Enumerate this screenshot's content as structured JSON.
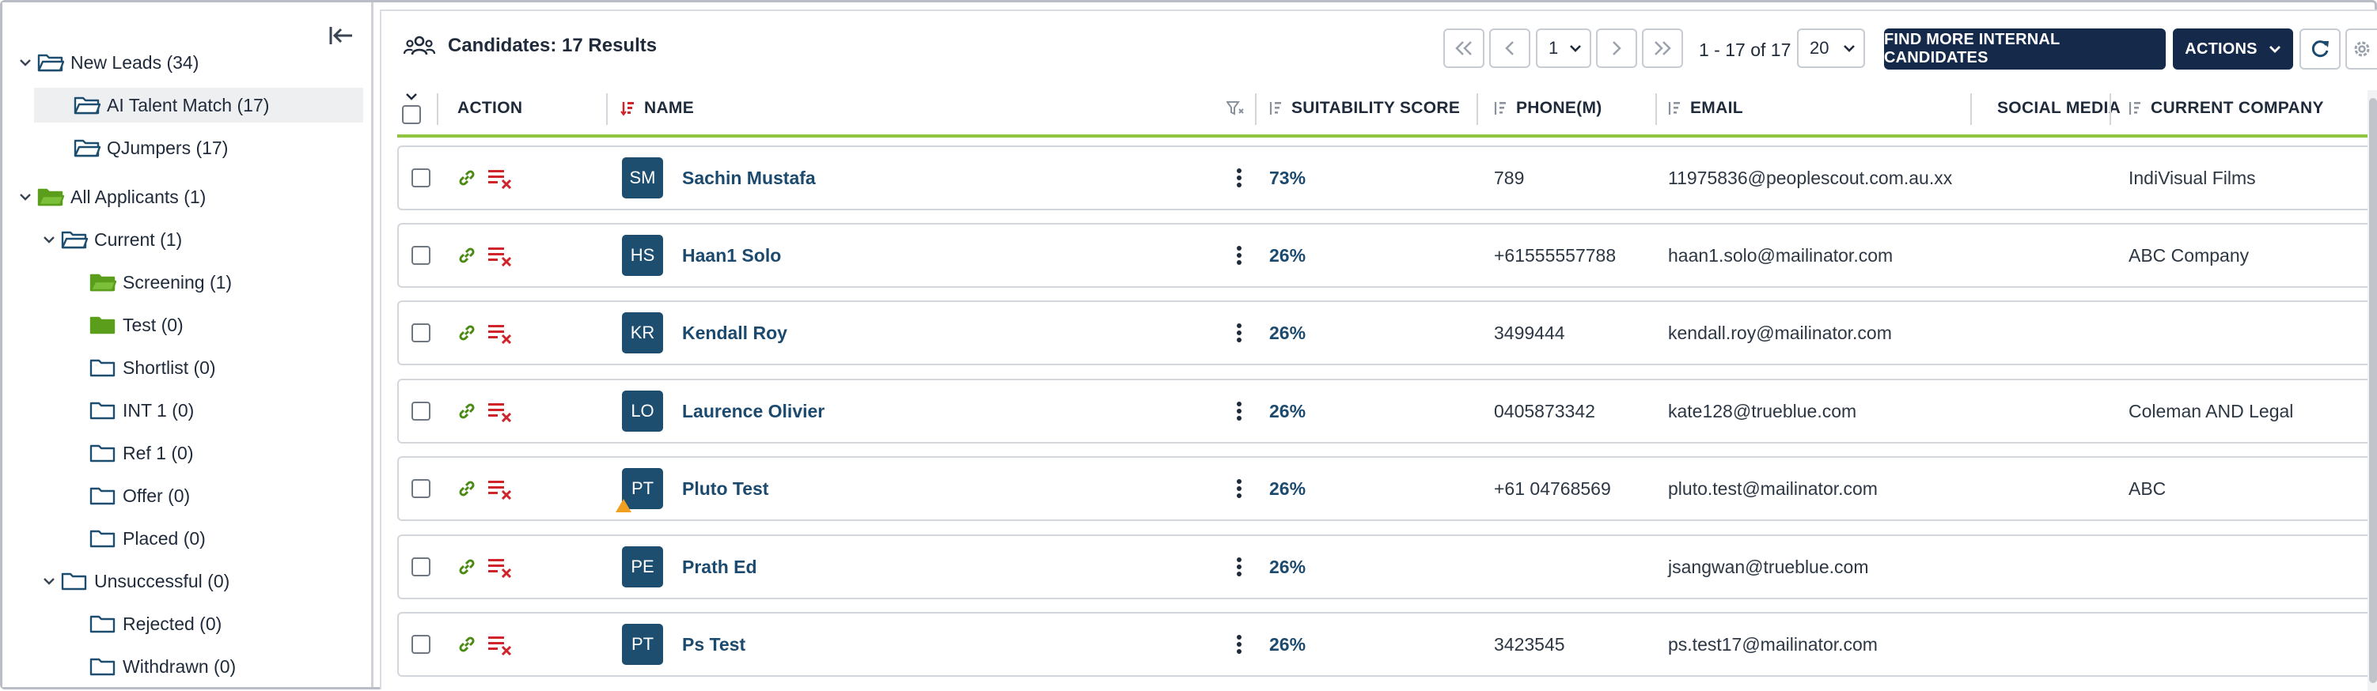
{
  "sidebar": {
    "tree": [
      {
        "label": "New Leads (34)",
        "level": 0,
        "expanded": true,
        "folder": "outline-open"
      },
      {
        "label": "AI Talent Match (17)",
        "level": 1,
        "selected": true,
        "folder": "outline-open"
      },
      {
        "label": "QJumpers (17)",
        "level": 1,
        "folder": "outline-open"
      },
      {
        "label": "All Applicants (1)",
        "level": 0,
        "expanded": true,
        "folder": "green-open"
      },
      {
        "label": "Current (1)",
        "level": 1,
        "expanded": true,
        "folder": "outline-open"
      },
      {
        "label": "Screening (1)",
        "level": 2,
        "folder": "green-open"
      },
      {
        "label": "Test (0)",
        "level": 2,
        "folder": "green"
      },
      {
        "label": "Shortlist (0)",
        "level": 2,
        "folder": "outline"
      },
      {
        "label": "INT 1 (0)",
        "level": 2,
        "folder": "outline"
      },
      {
        "label": "Ref 1 (0)",
        "level": 2,
        "folder": "outline"
      },
      {
        "label": "Offer (0)",
        "level": 2,
        "folder": "outline"
      },
      {
        "label": "Placed (0)",
        "level": 2,
        "folder": "outline"
      },
      {
        "label": "Unsuccessful (0)",
        "level": 1,
        "expanded": true,
        "folder": "outline"
      },
      {
        "label": "Rejected (0)",
        "level": 2,
        "folder": "outline"
      },
      {
        "label": "Withdrawn (0)",
        "level": 2,
        "folder": "outline"
      }
    ]
  },
  "toolbar": {
    "title": "Candidates: 17 Results",
    "page_value": "1",
    "range_text": "1 - 17 of 17",
    "page_size": "20",
    "find_more_label": "FIND MORE INTERNAL CANDIDATES",
    "actions_label": "ACTIONS"
  },
  "columns": {
    "action": "ACTION",
    "name": "NAME",
    "suitability": "SUITABILITY SCORE",
    "phone": "PHONE(M)",
    "email": "EMAIL",
    "social": "SOCIAL MEDIA",
    "company": "CURRENT COMPANY"
  },
  "rows": [
    {
      "initials": "SM",
      "name": "Sachin Mustafa",
      "score": "73%",
      "phone": "789",
      "email": "11975836@peoplescout.com.au.xx",
      "company": "IndiVisual Films",
      "warning": false
    },
    {
      "initials": "HS",
      "name": "Haan1 Solo",
      "score": "26%",
      "phone": "+61555557788",
      "email": "haan1.solo@mailinator.com",
      "company": "ABC Company",
      "warning": false
    },
    {
      "initials": "KR",
      "name": "Kendall Roy",
      "score": "26%",
      "phone": "3499444",
      "email": "kendall.roy@mailinator.com",
      "company": "",
      "warning": false
    },
    {
      "initials": "LO",
      "name": "Laurence Olivier",
      "score": "26%",
      "phone": "0405873342",
      "email": "kate128@trueblue.com",
      "company": "Coleman AND Legal",
      "warning": false
    },
    {
      "initials": "PT",
      "name": "Pluto Test",
      "score": "26%",
      "phone": "+61 04768569",
      "email": "pluto.test@mailinator.com",
      "company": "ABC",
      "warning": true
    },
    {
      "initials": "PE",
      "name": "Prath Ed",
      "score": "26%",
      "phone": "",
      "email": "jsangwan@trueblue.com",
      "company": "",
      "warning": false
    },
    {
      "initials": "PT",
      "name": "Ps Test",
      "score": "26%",
      "phone": "3423545",
      "email": "ps.test17@mailinator.com",
      "company": "",
      "warning": false
    }
  ],
  "colors": {
    "navy": "#15294b",
    "avatar": "#1d4e6f",
    "link": "#1c4a6e",
    "header_accent": "#8ec43e",
    "folder_green": "#5a9e1c",
    "folder_outline": "#1d4e6f",
    "action_link": "#4a8a12",
    "action_remove": "#d0242b"
  }
}
